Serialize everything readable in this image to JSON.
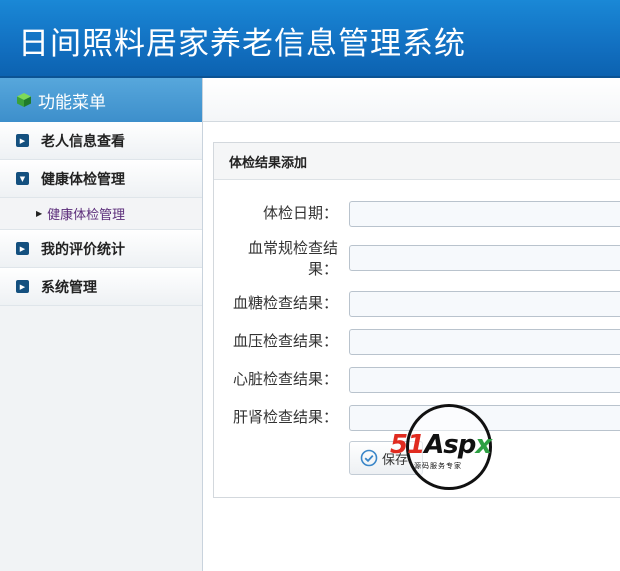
{
  "header": {
    "title": "日间照料居家养老信息管理系统"
  },
  "sidebar": {
    "menu_title": "功能菜单",
    "items": [
      {
        "label": "老人信息查看",
        "state": "collapsed"
      },
      {
        "label": "健康体检管理",
        "state": "expanded"
      },
      {
        "label": "我的评价统计",
        "state": "collapsed"
      },
      {
        "label": "系统管理",
        "state": "collapsed"
      }
    ],
    "subitems": [
      {
        "label": "健康体检管理"
      }
    ]
  },
  "panel": {
    "title": "体检结果添加",
    "fields": [
      {
        "label": "体检日期：",
        "value": ""
      },
      {
        "label": "血常规检查结果：",
        "value": ""
      },
      {
        "label": "血糖检查结果：",
        "value": ""
      },
      {
        "label": "血压检查结果：",
        "value": ""
      },
      {
        "label": "心脏检查结果：",
        "value": ""
      },
      {
        "label": "肝肾检查结果：",
        "value": ""
      }
    ],
    "save_label": "保存"
  },
  "watermark": {
    "brand_51": "51",
    "brand_asp": "Asp",
    "brand_x": "x",
    "slogan": "源码服务专家"
  },
  "colors": {
    "header_blue": "#1270c1",
    "menu_blue": "#3d8fcb",
    "icon_navy": "#14507f",
    "sublink_purple": "#5b2d7a"
  }
}
